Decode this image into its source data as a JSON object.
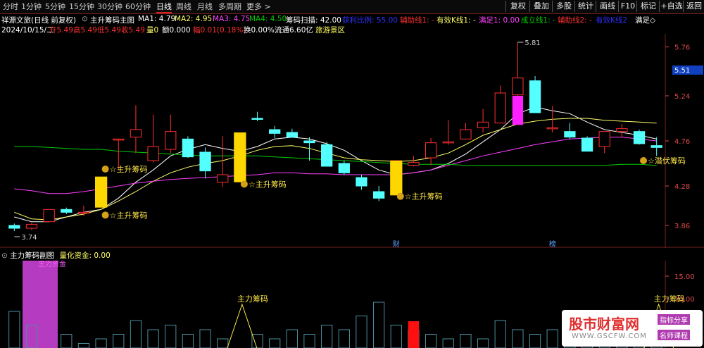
{
  "toolbar": {
    "tabs": [
      "分时",
      "1分钟",
      "5分钟",
      "15分钟",
      "30分钟",
      "60分钟",
      "日线",
      "周线",
      "月线",
      "多周期",
      "更多 >"
    ],
    "active_tab": "日线",
    "right_buttons": [
      "复权",
      "叠加",
      "多股",
      "统计",
      "画线",
      "F10",
      "标记",
      "+自选",
      "返回"
    ]
  },
  "info_row": {
    "stock_name": "祥源文旅(日线 前复权)",
    "indicator": "主升筹码主图",
    "ma1": "MA1: 4.79",
    "ma2": "MA2: 4.95",
    "ma3": "MA3: 4.75",
    "ma4": "MA4: 4.50",
    "scan": "筹码扫描: 42.00",
    "extra1": "获利比例: 55.00",
    "extra2": "辅助线1: -",
    "extra3": "有效K线1: -",
    "extra4": "满足1: 0.00",
    "extra5": "成立线1: -",
    "extra6": "辅助线2: -",
    "extra7": "有效K线2",
    "satisfy": "满足◇",
    "date": "2024/10/15/二",
    "open": "开5.49",
    "high": "高5.49",
    "low": "低5.49",
    "close": "收5.49",
    "vol": "量0",
    "amount": "额0.000",
    "change": "幅0.01(0.18%)",
    "turnover": "换0.00%",
    "circulation": "流通6.60亿",
    "sector": "旅游景区"
  },
  "colors": {
    "up": "#ff3030",
    "down": "#54ffff",
    "ma1": "#ffffff",
    "ma2": "#ffff66",
    "ma3": "#ff40ff",
    "ma4": "#00cc00",
    "signal_bar": "#ffd700",
    "magenta": "#ff20ff",
    "axis": "#e04848",
    "annotation": "#ffe84a"
  },
  "chart_data": {
    "type": "candlestick",
    "y_axis_ticks": [
      "5.76",
      "5.24",
      "4.76",
      "4.28",
      "3.86"
    ],
    "price_label": "5.51",
    "ylim": [
      3.62,
      5.9
    ],
    "high_label": "5.81",
    "low_label": "3.74",
    "candles": [
      {
        "o": 3.86,
        "h": 3.88,
        "l": 3.8,
        "c": 3.83
      },
      {
        "o": 3.83,
        "h": 3.9,
        "l": 3.81,
        "c": 3.87
      },
      {
        "o": 3.9,
        "h": 4.03,
        "l": 3.9,
        "c": 4.03
      },
      {
        "o": 4.03,
        "h": 4.05,
        "l": 3.98,
        "c": 4.0
      },
      {
        "o": 4.0,
        "h": 4.07,
        "l": 3.96,
        "c": 4.0
      },
      {
        "o": 4.08,
        "h": 4.35,
        "l": 4.07,
        "c": 4.35
      },
      {
        "o": 4.78,
        "h": 4.78,
        "l": 4.45,
        "c": 4.78
      },
      {
        "o": 4.8,
        "h": 5.14,
        "l": 4.63,
        "c": 4.88
      },
      {
        "o": 4.55,
        "h": 5.04,
        "l": 4.53,
        "c": 4.7
      },
      {
        "o": 4.67,
        "h": 5.04,
        "l": 4.63,
        "c": 4.86
      },
      {
        "o": 4.78,
        "h": 4.81,
        "l": 4.58,
        "c": 4.59
      },
      {
        "o": 4.64,
        "h": 4.69,
        "l": 4.36,
        "c": 4.44
      },
      {
        "o": 4.32,
        "h": 4.81,
        "l": 4.27,
        "c": 4.4
      },
      {
        "o": 4.51,
        "h": 4.81,
        "l": 4.4,
        "c": 4.81
      },
      {
        "o": 5.0,
        "h": 5.07,
        "l": 4.97,
        "c": 4.99
      },
      {
        "o": 4.88,
        "h": 4.92,
        "l": 4.79,
        "c": 4.84
      },
      {
        "o": 4.85,
        "h": 4.89,
        "l": 4.8,
        "c": 4.8
      },
      {
        "o": 4.76,
        "h": 4.8,
        "l": 4.55,
        "c": 4.74
      },
      {
        "o": 4.72,
        "h": 4.75,
        "l": 4.49,
        "c": 4.49
      },
      {
        "o": 4.52,
        "h": 4.55,
        "l": 4.4,
        "c": 4.42
      },
      {
        "o": 4.37,
        "h": 4.4,
        "l": 4.24,
        "c": 4.28
      },
      {
        "o": 4.22,
        "h": 4.28,
        "l": 4.12,
        "c": 4.15
      },
      {
        "o": 4.24,
        "h": 4.55,
        "l": 4.2,
        "c": 4.55
      },
      {
        "o": 4.5,
        "h": 4.6,
        "l": 4.49,
        "c": 4.53
      },
      {
        "o": 4.58,
        "h": 4.79,
        "l": 4.5,
        "c": 4.74
      },
      {
        "o": 4.75,
        "h": 4.98,
        "l": 4.72,
        "c": 4.75
      },
      {
        "o": 4.78,
        "h": 4.95,
        "l": 4.78,
        "c": 4.88
      },
      {
        "o": 4.9,
        "h": 5.1,
        "l": 4.85,
        "c": 4.96
      },
      {
        "o": 4.95,
        "h": 5.35,
        "l": 4.95,
        "c": 5.27
      },
      {
        "o": 5.25,
        "h": 5.81,
        "l": 5.18,
        "c": 5.43
      },
      {
        "o": 5.4,
        "h": 5.45,
        "l": 5.06,
        "c": 5.06
      },
      {
        "o": 4.9,
        "h": 5.13,
        "l": 4.85,
        "c": 4.9
      },
      {
        "o": 4.86,
        "h": 4.95,
        "l": 4.78,
        "c": 4.8
      },
      {
        "o": 4.79,
        "h": 4.81,
        "l": 4.65,
        "c": 4.65
      },
      {
        "o": 4.7,
        "h": 4.86,
        "l": 4.63,
        "c": 4.86
      },
      {
        "o": 4.86,
        "h": 4.94,
        "l": 4.8,
        "c": 4.89
      },
      {
        "o": 4.86,
        "h": 4.88,
        "l": 4.72,
        "c": 4.73
      },
      {
        "o": 4.71,
        "h": 4.8,
        "l": 4.6,
        "c": 4.69
      }
    ],
    "ma1": [
      3.95,
      3.9,
      3.9,
      3.95,
      4.0,
      4.03,
      4.15,
      4.32,
      4.45,
      4.6,
      4.67,
      4.72,
      4.68,
      4.65,
      4.7,
      4.78,
      4.8,
      4.78,
      4.73,
      4.66,
      4.55,
      4.45,
      4.4,
      4.42,
      4.45,
      4.52,
      4.62,
      4.75,
      4.88,
      5.05,
      5.12,
      5.08,
      5.05,
      4.96,
      4.88,
      4.85,
      4.82,
      4.78
    ],
    "ma2": [
      4.0,
      3.93,
      3.92,
      3.95,
      3.98,
      4.03,
      4.12,
      4.22,
      4.33,
      4.42,
      4.48,
      4.52,
      4.55,
      4.6,
      4.66,
      4.7,
      4.71,
      4.68,
      4.63,
      4.58,
      4.56,
      4.55,
      4.54,
      4.55,
      4.58,
      4.63,
      4.72,
      4.82,
      4.88,
      4.94,
      4.97,
      4.99,
      5.0,
      5.0,
      4.98,
      4.97,
      4.96,
      4.95
    ],
    "ma3": [
      4.25,
      4.23,
      4.2,
      4.2,
      4.22,
      4.25,
      4.28,
      4.31,
      4.33,
      4.35,
      4.36,
      4.37,
      4.38,
      4.39,
      4.4,
      4.42,
      4.42,
      4.41,
      4.41,
      4.4,
      4.4,
      4.4,
      4.4,
      4.42,
      4.45,
      4.5,
      4.55,
      4.6,
      4.64,
      4.68,
      4.72,
      4.75,
      4.78,
      4.79,
      4.8,
      4.8,
      4.78,
      4.76
    ],
    "ma4": [
      4.7,
      4.7,
      4.69,
      4.68,
      4.67,
      4.67,
      4.65,
      4.64,
      4.63,
      4.62,
      4.61,
      4.6,
      4.6,
      4.6,
      4.6,
      4.59,
      4.58,
      4.57,
      4.56,
      4.55,
      4.54,
      4.53,
      4.52,
      4.51,
      4.51,
      4.51,
      4.5,
      4.5,
      4.5,
      4.5,
      4.5,
      4.5,
      4.5,
      4.5,
      4.5,
      4.51,
      4.51,
      4.5
    ],
    "signal_bars": [
      {
        "i": 5,
        "top": 4.38,
        "bottom": 4.05
      },
      {
        "i": 13,
        "top": 4.85,
        "bottom": 4.32
      },
      {
        "i": 22,
        "top": 4.55,
        "bottom": 4.18
      }
    ],
    "magenta_bar": {
      "i": 29,
      "top": 5.24,
      "bottom": 4.93
    },
    "annotations": [
      {
        "i": 5,
        "label": "主升筹码",
        "price": 4.46
      },
      {
        "i": 13,
        "label": "主升筹码",
        "price": 4.3
      },
      {
        "i": 22,
        "label": "主升筹码",
        "price": 4.17
      },
      {
        "i": 5,
        "label": "主升筹码",
        "price": 3.97
      },
      {
        "i": 36,
        "label": "潜伏筹码",
        "price": 4.55
      }
    ],
    "date_markers": [
      {
        "i": 22,
        "label": "财"
      },
      {
        "i": 31,
        "label": "榜"
      }
    ]
  },
  "sub_chart": {
    "title": "主力筹码副图",
    "indicator": "量化资金: 0.00",
    "y_ticks": [
      "15.00",
      "10.00"
    ],
    "left_label": "主力资金",
    "annotations": [
      {
        "label": "主力筹码",
        "i": 13
      },
      {
        "label": "主力筹码",
        "i": 37
      }
    ],
    "bars": [
      {
        "i": 0,
        "v": 8
      },
      {
        "i": 1,
        "v": 5
      },
      {
        "i": 3,
        "v": 3
      },
      {
        "i": 4,
        "v": 1
      },
      {
        "i": 5,
        "v": 2
      },
      {
        "i": 6,
        "v": 3
      },
      {
        "i": 7,
        "v": 6
      },
      {
        "i": 8,
        "v": 4
      },
      {
        "i": 9,
        "v": 5
      },
      {
        "i": 10,
        "v": 3
      },
      {
        "i": 11,
        "v": 4
      },
      {
        "i": 12,
        "v": 2
      },
      {
        "i": 14,
        "v": 3
      },
      {
        "i": 15,
        "v": 2
      },
      {
        "i": 16,
        "v": 4
      },
      {
        "i": 17,
        "v": 3
      },
      {
        "i": 18,
        "v": 5
      },
      {
        "i": 19,
        "v": 4
      },
      {
        "i": 20,
        "v": 7
      },
      {
        "i": 21,
        "v": 10
      },
      {
        "i": 22,
        "v": 5
      },
      {
        "i": 23,
        "v": 4
      },
      {
        "i": 24,
        "v": 3
      },
      {
        "i": 25,
        "v": 2
      },
      {
        "i": 26,
        "v": 3
      },
      {
        "i": 27,
        "v": 2
      },
      {
        "i": 28,
        "v": 6
      },
      {
        "i": 29,
        "v": 4
      },
      {
        "i": 30,
        "v": 3
      },
      {
        "i": 31,
        "v": 4
      },
      {
        "i": 32,
        "v": 3
      },
      {
        "i": 33,
        "v": 2
      },
      {
        "i": 34,
        "v": 3
      },
      {
        "i": 35,
        "v": 2
      },
      {
        "i": 36,
        "v": 1
      },
      {
        "i": 37,
        "v": 2
      }
    ]
  },
  "watermark": {
    "title": "股市财富网",
    "url": "WWW.GSCFW.COM",
    "tag1": "指标分享",
    "tag2": "名师课程"
  }
}
